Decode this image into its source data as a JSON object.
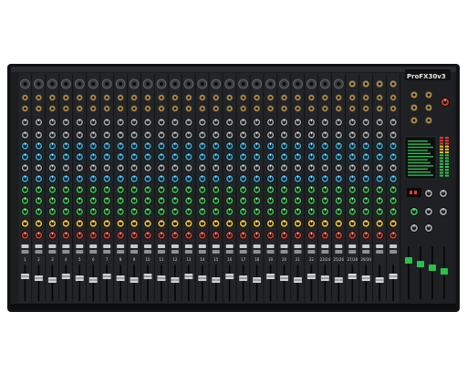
{
  "product": {
    "brand_logo": "Pro",
    "model_logo": "ProFX30v3"
  },
  "mixer": {
    "channel_strips": 24,
    "stereo_strips": 4,
    "channel_numbers": [
      "1",
      "2",
      "3",
      "4",
      "5",
      "6",
      "7",
      "8",
      "9",
      "10",
      "11",
      "12",
      "13",
      "14",
      "15",
      "16",
      "17",
      "18",
      "19",
      "20",
      "21",
      "22",
      "23/24",
      "25/26",
      "27/28",
      "29/30"
    ],
    "colors": {
      "chassis": "#1c1d1f",
      "strip": "#222427",
      "knob_grey": "#9aa0a6",
      "knob_blue": "#2aa6d9",
      "knob_green": "#2fbf4a",
      "knob_yellow": "#f0c020",
      "knob_red": "#d83a2a",
      "fader_cap_master": "#27c24c",
      "lcd": "#0b0f0d",
      "lcd_text": "#39e26a",
      "background": "#ffffff"
    },
    "icons": [
      "xlr-jack-icon",
      "trs-jack-icon",
      "knob-icon",
      "fader-icon",
      "led-meter-icon",
      "mute-button-icon"
    ]
  }
}
